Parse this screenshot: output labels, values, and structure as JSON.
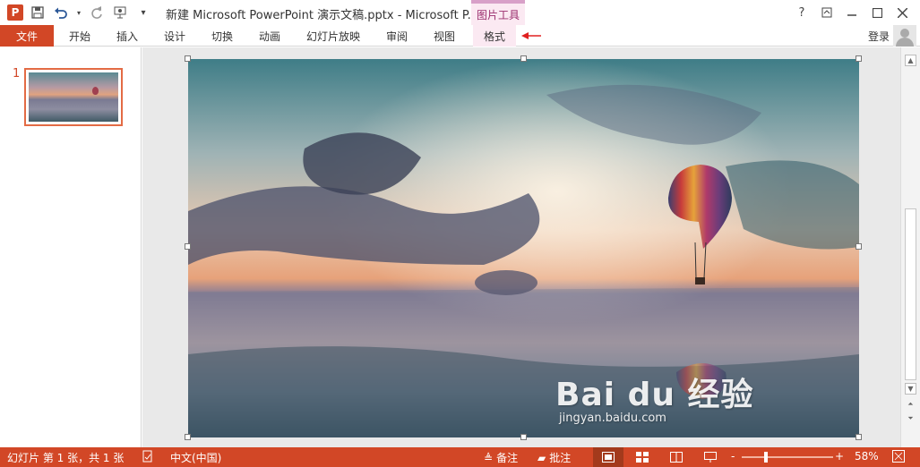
{
  "window": {
    "title": "新建 Microsoft PowerPoint 演示文稿.pptx - Microsoft P...",
    "context_tab_group": "图片工具",
    "help_glyph": "?",
    "login_label": "登录"
  },
  "ribbon": {
    "file_label": "文件",
    "tabs": [
      "开始",
      "插入",
      "设计",
      "切换",
      "动画",
      "幻灯片放映",
      "审阅",
      "视图"
    ],
    "context_tab": "格式"
  },
  "thumbnails": {
    "slide_number": "1"
  },
  "statusbar": {
    "slide_info": "幻灯片 第 1 张，共 1 张",
    "language": "中文(中国)",
    "notes_label": "备注",
    "comments_label": "批注",
    "zoom_minus": "-",
    "zoom_plus": "+",
    "zoom_level": "58%"
  },
  "watermark": {
    "brand": "Bai du 经验",
    "url": "jingyan.baidu.com"
  },
  "colors": {
    "accent": "#d24726",
    "context_tab_bg": "#fbe9f2",
    "context_tab_text": "#9b2f6e"
  },
  "icons": {
    "app": "powerpoint-icon",
    "save": "save-icon",
    "undo": "undo-icon",
    "redo": "redo-icon",
    "present": "present-from-start-icon",
    "customize": "customize-qat-icon",
    "arrow": "red-arrow-annotation"
  }
}
